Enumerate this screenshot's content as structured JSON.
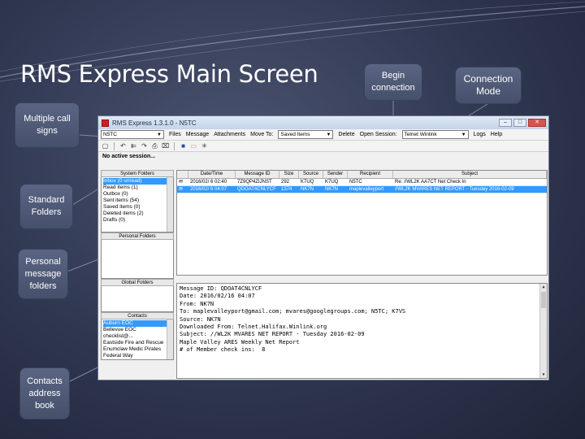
{
  "slide": {
    "title": "RMS Express Main Screen",
    "callouts": {
      "begin_connection": "Begin connection",
      "connection_mode": "Connection Mode",
      "multiple_call_signs": "Multiple call signs",
      "standard_folders": "Standard Folders",
      "personal_folders": "Personal message folders",
      "contacts_book": "Contacts address book"
    }
  },
  "window": {
    "title": "RMS Express 1.3.1.0 - N5TC",
    "controls": {
      "minimize": "–",
      "maximize": "□",
      "close": "✕"
    }
  },
  "menubar": {
    "callsign": "N5TC",
    "items": [
      "Files",
      "Message",
      "Attachments",
      "Move To:"
    ],
    "move_to_value": "Saved Items",
    "delete": "Delete",
    "open_session": "Open Session:",
    "session_type": "Telnet Winlink",
    "logs": "Logs",
    "help": "Help"
  },
  "toolbar": {
    "icons": [
      "new-message-icon",
      "reply-icon",
      "reply-all-icon",
      "forward-icon",
      "print-icon",
      "attach-icon",
      "save-icon",
      "folder-icon",
      "tools-icon"
    ]
  },
  "status": {
    "session": "No active session..."
  },
  "system_folders": {
    "header": "System Folders",
    "items": [
      "Inbox (0 unread)",
      "Read items (1)",
      "Outbox (0)",
      "Sent items (54)",
      "Saved items (0)",
      "Deleted items (2)",
      "Drafts (0)"
    ],
    "selected": 0,
    "footer": "Personal Folders"
  },
  "global_folders": {
    "header": "Global Folders"
  },
  "contacts": {
    "header": "Contacts",
    "items": [
      "Auburn EOC",
      "Bellevue EOC",
      "checklist@...",
      "Eastside Fire and Rescue",
      "Enumclaw Medic Pirates",
      "Federal Way"
    ],
    "selected": 0
  },
  "message_table": {
    "columns": [
      "Date/Time",
      "Message ID",
      "Size",
      "Source",
      "Sender",
      "Recipient",
      "Subject"
    ],
    "rows": [
      {
        "icon": "open-envelope-icon",
        "cells": [
          "2016/02/ 6 02:40",
          "7Z9QP4ZIJNST",
          "292",
          "K7UQ",
          "K7UQ",
          "N5TC",
          "Re: //WL2K AA7CT Net Check In"
        ]
      },
      {
        "icon": "closed-envelope-icon",
        "cells": [
          "2016/02/ 6 04:07",
          "QDOAT4CNLYCF",
          "1374",
          "NK7N",
          "NK7N",
          "maplevalleyport",
          "//WL2K MVARES NET REPORT - Tuesday 2016-02-09"
        ]
      }
    ],
    "selected": 1
  },
  "message_view": {
    "lines": [
      "Message ID: QDOAT4CNLYCF",
      "Date: 2016/02/16 04:07",
      "From: NK7N",
      "To: maplevalleyport@gmail.com; mvares@googlegroups.com; N5TC; K7VS",
      "Source: NK7N",
      "Downloaded From: Telnet.Halifax.Winlink.org",
      "Subject: //WL2K MVARES NET REPORT - Tuesday 2016-02-09",
      "",
      "Maple Valley ARES Weekly Net Report",
      "",
      "# of Member check ins:  8"
    ]
  }
}
